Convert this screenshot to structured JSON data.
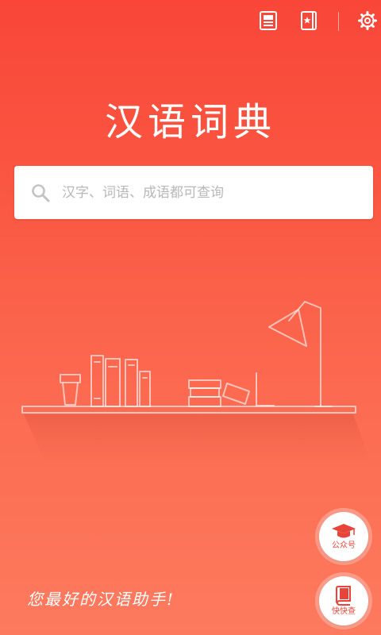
{
  "header": {
    "icons": [
      "newspaper-icon",
      "bookmark-book-icon",
      "settings-gear-icon"
    ]
  },
  "app": {
    "title": "汉语词典",
    "slogan": "您最好的汉语助手!"
  },
  "search": {
    "placeholder": "汉字、词语、成语都可查询",
    "value": ""
  },
  "floating_buttons": {
    "gongzhonghao": {
      "label": "公众号",
      "icon": "graduation-cap-icon"
    },
    "kuaikuaicha": {
      "label": "快快查",
      "icon": "book-icon"
    }
  },
  "colors": {
    "background_top": "#f94638",
    "background_bottom": "#fd7a5e",
    "accent": "#e8443a",
    "placeholder": "#b8b8b8"
  }
}
